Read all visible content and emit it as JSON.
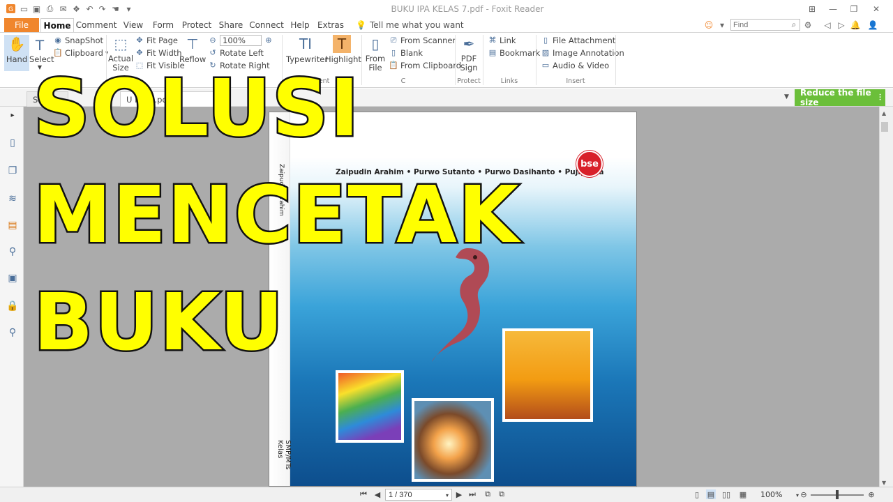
{
  "window": {
    "title": "BUKU IPA KELAS 7.pdf - Foxit Reader",
    "quick_access_icons": [
      "app-logo-icon",
      "open-icon",
      "save-icon",
      "print-icon",
      "email-icon",
      "stamp-icon",
      "undo-icon",
      "redo-icon",
      "hand-select-icon",
      "customize-icon"
    ]
  },
  "menu": {
    "file": "File",
    "tabs": [
      "Home",
      "Comment",
      "View",
      "Form",
      "Protect",
      "Share",
      "Connect",
      "Help",
      "Extras"
    ],
    "active_tab": "Home",
    "tell_me": "Tell me what you want",
    "find_placeholder": "Find"
  },
  "ribbon": {
    "hand": "Hand",
    "select": "Select",
    "snapshot": "SnapShot",
    "clipboard": "Clipboard",
    "actual_size": "Actual Size",
    "fit_page": "Fit Page",
    "fit_width": "Fit Width",
    "fit_visible": "Fit Visible",
    "reflow": "Reflow",
    "zoom_value": "100%",
    "rotate_left": "Rotate Left",
    "rotate_right": "Rotate Right",
    "typewriter": "Typewriter",
    "highlight": "Highlight",
    "comment_group": "ment",
    "from_file": "From File",
    "from_scanner": "From Scanner",
    "blank": "Blank",
    "from_clipboard": "From Clipboard",
    "create_group": "C",
    "pdf_sign": "PDF Sign",
    "protect_group": "Protect",
    "link": "Link",
    "bookmark": "Bookmark",
    "links_group": "Links",
    "file_attachment": "File Attachment",
    "image_annotation": "Image Annotation",
    "audio_video": "Audio & Video",
    "insert_group": "Insert"
  },
  "doc_tabs": {
    "tab1": "S",
    "tab2": "BUKU IPA KELAS 7.pdf",
    "tab2_visible": "U IPA        7.pd"
  },
  "reduce_button": "Reduce the file size",
  "page": {
    "authors": "Zaipudin Arahim • Purwo Sutanto • Purwo Dasihanto • Pujiyanta",
    "badge": "bse",
    "spine_text": "Zaipudin Arahim",
    "spine_bottom": "SMP/MTs Kelas"
  },
  "overlay": {
    "line1": "SOLUSI",
    "line2": "MENCETAK",
    "line3": "BUKU"
  },
  "statusbar": {
    "page_indicator": "1 / 370",
    "zoom": "100%"
  },
  "colors": {
    "file_tab": "#f0862d",
    "reduce_button": "#6bbf3a",
    "overlay_text": "#ffff00",
    "canvas": "#ababab"
  }
}
